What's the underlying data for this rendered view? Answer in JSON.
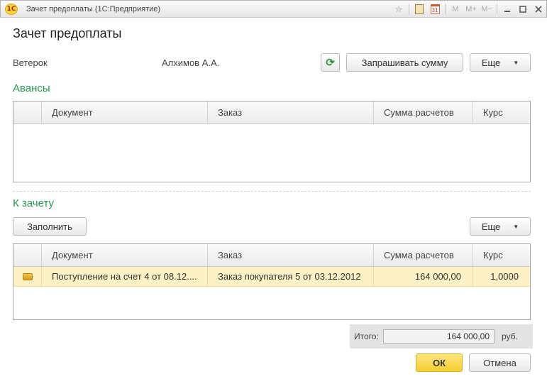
{
  "window": {
    "title": "Зачет предоплаты  (1С:Предприятие)",
    "logo_text": "1С",
    "toolbar": [
      "favorites-star-icon",
      "calculator-icon",
      "calendar-icon",
      "M",
      "M+",
      "M−",
      "minimize-icon",
      "maximize-icon",
      "close-icon"
    ],
    "calendar_day": "31",
    "m": "M",
    "m_plus": "M+",
    "m_minus": "M−"
  },
  "page_title": "Зачет предоплаты",
  "header": {
    "counterparty": "Ветерок",
    "person": "Алхимов А.А.",
    "request_sum_button": "Запрашивать сумму",
    "more_button": "Еще"
  },
  "advances": {
    "title": "Авансы",
    "columns": [
      "Документ",
      "Заказ",
      "Сумма расчетов",
      "Курс"
    ],
    "rows": []
  },
  "offset": {
    "title": "К зачету",
    "fill_button": "Заполнить",
    "more_button": "Еще",
    "columns": [
      "Документ",
      "Заказ",
      "Сумма расчетов",
      "Курс"
    ],
    "rows": [
      {
        "document": "Поступление на счет 4 от 08.12....",
        "order": "Заказ покупателя 5 от 03.12.2012",
        "sum": "164 000,00",
        "rate": "1,0000"
      }
    ]
  },
  "total": {
    "label": "Итого:",
    "value": "164 000,00",
    "unit": "руб."
  },
  "footer": {
    "ok": "ОК",
    "cancel": "Отмена"
  },
  "colors": {
    "section_title": "#1e9a4a",
    "selected_row": "#fbf1c4",
    "ok_button": "#f7cf30"
  }
}
